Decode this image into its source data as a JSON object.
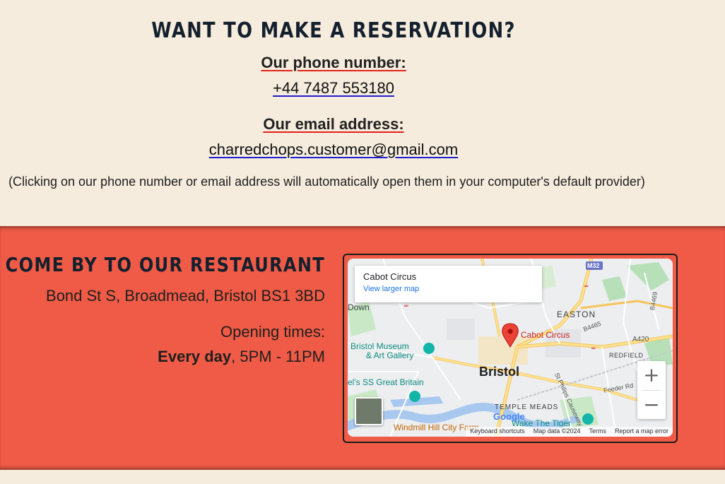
{
  "reservation": {
    "heading": "WANT TO MAKE A RESERVATION?",
    "phone_label": "Our phone number:",
    "phone": "+44 7487 553180",
    "email_label": "Our email address:",
    "email": "charredchops.customer@gmail.com",
    "note": "(Clicking on our phone number or email address will automatically open them in your computer's default provider)"
  },
  "visit": {
    "heading": "COME BY TO OUR RESTAURANT",
    "address": "Bond St S, Broadmead, Bristol BS1 3BD",
    "hours_label": "Opening times:",
    "hours_days": "Every day",
    "hours_time": ", 5PM - 11PM"
  },
  "map": {
    "place_name": "Cabot Circus",
    "view_larger": "View larger map",
    "pin_label": "Cabot Circus",
    "labels": {
      "bristol": "Bristol",
      "easton": "EASTON",
      "redfield": "REDFIELD",
      "temple_meads": "TEMPLE MEADS",
      "museum_1": "Bristol Museum",
      "museum_2": "& Art Gallery",
      "ss_great_britain": "el's SS Great Britain",
      "windmill_hill": "Windmill Hill City Farm",
      "wake_the_tiger": "Wake The Tiger",
      "down": "Down",
      "feeder_rd": "Feeder Rd",
      "st_philips": "St Philips Causeway",
      "m32": "M32",
      "a420": "A420",
      "b4465": "B4465",
      "b4469": "B4469"
    },
    "footer": {
      "shortcuts": "Keyboard shortcuts",
      "data": "Map data ©2024",
      "terms": "Terms",
      "report": "Report a map error"
    },
    "google": "Google",
    "zoom_in": "+",
    "zoom_out": "−"
  },
  "colors": {
    "cream": "#f6ecdd",
    "red": "#ef5b46",
    "navy": "#14202e"
  }
}
